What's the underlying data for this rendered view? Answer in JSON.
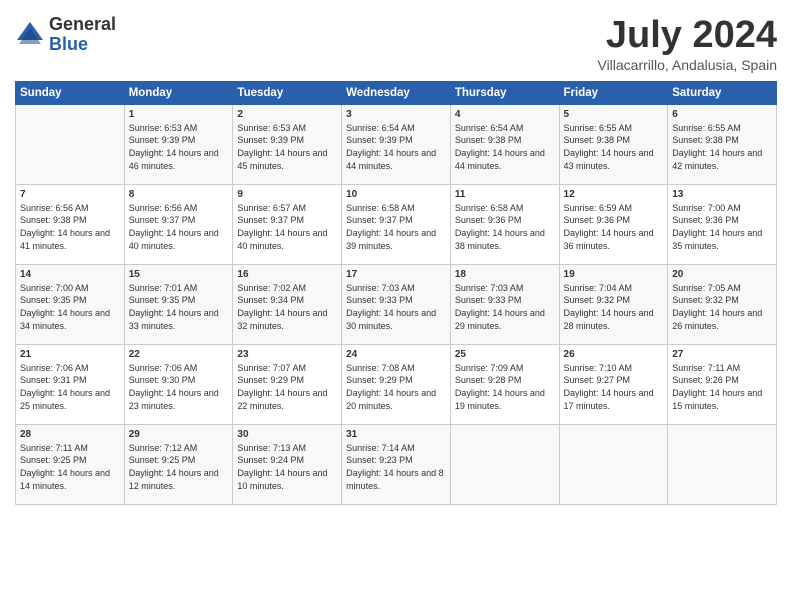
{
  "logo": {
    "general": "General",
    "blue": "Blue"
  },
  "title": "July 2024",
  "location": "Villacarrillo, Andalusia, Spain",
  "weekdays": [
    "Sunday",
    "Monday",
    "Tuesday",
    "Wednesday",
    "Thursday",
    "Friday",
    "Saturday"
  ],
  "weeks": [
    [
      {
        "day": "",
        "sunrise": "",
        "sunset": "",
        "daylight": ""
      },
      {
        "day": "1",
        "sunrise": "Sunrise: 6:53 AM",
        "sunset": "Sunset: 9:39 PM",
        "daylight": "Daylight: 14 hours and 46 minutes."
      },
      {
        "day": "2",
        "sunrise": "Sunrise: 6:53 AM",
        "sunset": "Sunset: 9:39 PM",
        "daylight": "Daylight: 14 hours and 45 minutes."
      },
      {
        "day": "3",
        "sunrise": "Sunrise: 6:54 AM",
        "sunset": "Sunset: 9:39 PM",
        "daylight": "Daylight: 14 hours and 44 minutes."
      },
      {
        "day": "4",
        "sunrise": "Sunrise: 6:54 AM",
        "sunset": "Sunset: 9:38 PM",
        "daylight": "Daylight: 14 hours and 44 minutes."
      },
      {
        "day": "5",
        "sunrise": "Sunrise: 6:55 AM",
        "sunset": "Sunset: 9:38 PM",
        "daylight": "Daylight: 14 hours and 43 minutes."
      },
      {
        "day": "6",
        "sunrise": "Sunrise: 6:55 AM",
        "sunset": "Sunset: 9:38 PM",
        "daylight": "Daylight: 14 hours and 42 minutes."
      }
    ],
    [
      {
        "day": "7",
        "sunrise": "Sunrise: 6:56 AM",
        "sunset": "Sunset: 9:38 PM",
        "daylight": "Daylight: 14 hours and 41 minutes."
      },
      {
        "day": "8",
        "sunrise": "Sunrise: 6:56 AM",
        "sunset": "Sunset: 9:37 PM",
        "daylight": "Daylight: 14 hours and 40 minutes."
      },
      {
        "day": "9",
        "sunrise": "Sunrise: 6:57 AM",
        "sunset": "Sunset: 9:37 PM",
        "daylight": "Daylight: 14 hours and 40 minutes."
      },
      {
        "day": "10",
        "sunrise": "Sunrise: 6:58 AM",
        "sunset": "Sunset: 9:37 PM",
        "daylight": "Daylight: 14 hours and 39 minutes."
      },
      {
        "day": "11",
        "sunrise": "Sunrise: 6:58 AM",
        "sunset": "Sunset: 9:36 PM",
        "daylight": "Daylight: 14 hours and 38 minutes."
      },
      {
        "day": "12",
        "sunrise": "Sunrise: 6:59 AM",
        "sunset": "Sunset: 9:36 PM",
        "daylight": "Daylight: 14 hours and 36 minutes."
      },
      {
        "day": "13",
        "sunrise": "Sunrise: 7:00 AM",
        "sunset": "Sunset: 9:36 PM",
        "daylight": "Daylight: 14 hours and 35 minutes."
      }
    ],
    [
      {
        "day": "14",
        "sunrise": "Sunrise: 7:00 AM",
        "sunset": "Sunset: 9:35 PM",
        "daylight": "Daylight: 14 hours and 34 minutes."
      },
      {
        "day": "15",
        "sunrise": "Sunrise: 7:01 AM",
        "sunset": "Sunset: 9:35 PM",
        "daylight": "Daylight: 14 hours and 33 minutes."
      },
      {
        "day": "16",
        "sunrise": "Sunrise: 7:02 AM",
        "sunset": "Sunset: 9:34 PM",
        "daylight": "Daylight: 14 hours and 32 minutes."
      },
      {
        "day": "17",
        "sunrise": "Sunrise: 7:03 AM",
        "sunset": "Sunset: 9:33 PM",
        "daylight": "Daylight: 14 hours and 30 minutes."
      },
      {
        "day": "18",
        "sunrise": "Sunrise: 7:03 AM",
        "sunset": "Sunset: 9:33 PM",
        "daylight": "Daylight: 14 hours and 29 minutes."
      },
      {
        "day": "19",
        "sunrise": "Sunrise: 7:04 AM",
        "sunset": "Sunset: 9:32 PM",
        "daylight": "Daylight: 14 hours and 28 minutes."
      },
      {
        "day": "20",
        "sunrise": "Sunrise: 7:05 AM",
        "sunset": "Sunset: 9:32 PM",
        "daylight": "Daylight: 14 hours and 26 minutes."
      }
    ],
    [
      {
        "day": "21",
        "sunrise": "Sunrise: 7:06 AM",
        "sunset": "Sunset: 9:31 PM",
        "daylight": "Daylight: 14 hours and 25 minutes."
      },
      {
        "day": "22",
        "sunrise": "Sunrise: 7:06 AM",
        "sunset": "Sunset: 9:30 PM",
        "daylight": "Daylight: 14 hours and 23 minutes."
      },
      {
        "day": "23",
        "sunrise": "Sunrise: 7:07 AM",
        "sunset": "Sunset: 9:29 PM",
        "daylight": "Daylight: 14 hours and 22 minutes."
      },
      {
        "day": "24",
        "sunrise": "Sunrise: 7:08 AM",
        "sunset": "Sunset: 9:29 PM",
        "daylight": "Daylight: 14 hours and 20 minutes."
      },
      {
        "day": "25",
        "sunrise": "Sunrise: 7:09 AM",
        "sunset": "Sunset: 9:28 PM",
        "daylight": "Daylight: 14 hours and 19 minutes."
      },
      {
        "day": "26",
        "sunrise": "Sunrise: 7:10 AM",
        "sunset": "Sunset: 9:27 PM",
        "daylight": "Daylight: 14 hours and 17 minutes."
      },
      {
        "day": "27",
        "sunrise": "Sunrise: 7:11 AM",
        "sunset": "Sunset: 9:26 PM",
        "daylight": "Daylight: 14 hours and 15 minutes."
      }
    ],
    [
      {
        "day": "28",
        "sunrise": "Sunrise: 7:11 AM",
        "sunset": "Sunset: 9:25 PM",
        "daylight": "Daylight: 14 hours and 14 minutes."
      },
      {
        "day": "29",
        "sunrise": "Sunrise: 7:12 AM",
        "sunset": "Sunset: 9:25 PM",
        "daylight": "Daylight: 14 hours and 12 minutes."
      },
      {
        "day": "30",
        "sunrise": "Sunrise: 7:13 AM",
        "sunset": "Sunset: 9:24 PM",
        "daylight": "Daylight: 14 hours and 10 minutes."
      },
      {
        "day": "31",
        "sunrise": "Sunrise: 7:14 AM",
        "sunset": "Sunset: 9:23 PM",
        "daylight": "Daylight: 14 hours and 8 minutes."
      },
      {
        "day": "",
        "sunrise": "",
        "sunset": "",
        "daylight": ""
      },
      {
        "day": "",
        "sunrise": "",
        "sunset": "",
        "daylight": ""
      },
      {
        "day": "",
        "sunrise": "",
        "sunset": "",
        "daylight": ""
      }
    ]
  ]
}
